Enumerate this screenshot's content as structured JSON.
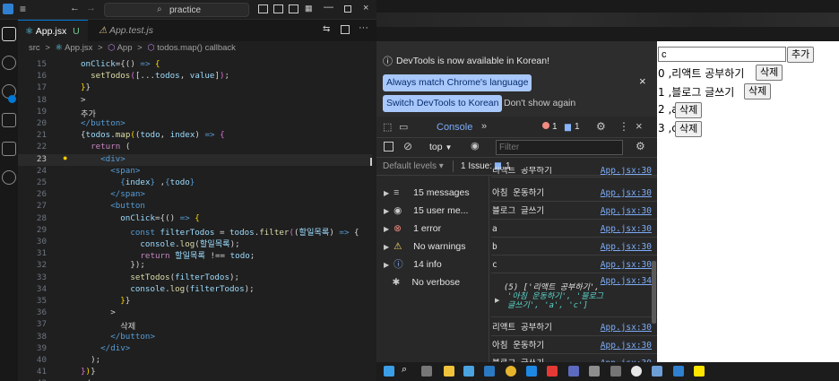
{
  "vscode": {
    "search": "practice",
    "tabs": [
      "App.jsx",
      "U",
      "App.test.js"
    ],
    "breadcrumb": [
      "src",
      ">",
      "App.jsx",
      ">",
      "App",
      ">",
      "todos.map() callback"
    ]
  },
  "code": [
    {
      "n": "15",
      "html": "<span class='v'>onClick</span>={() <span class='tg'>=&gt;</span> <span class='p'>{</span>"
    },
    {
      "n": "16",
      "html": "  <span class='f'>setTodos</span><span class='b'>(</span>[...<span class='v'>todos</span>, <span class='v'>value</span>]<span class='b'>)</span>;"
    },
    {
      "n": "17",
      "html": "<span class='p'>}</span>}"
    },
    {
      "n": "18",
      "html": "&gt;"
    },
    {
      "n": "19",
      "html": "추가"
    },
    {
      "n": "20",
      "html": "<span class='tg'>&lt;/button&gt;</span>"
    },
    {
      "n": "21",
      "html": "{<span class='v'>todos</span>.<span class='f'>map</span><span class='p'>(</span>(<span class='v'>todo</span>, <span class='v'>index</span>) <span class='tg'>=&gt;</span> <span class='b'>{</span>"
    },
    {
      "n": "22",
      "html": "  <span class='k'>return</span> ("
    },
    {
      "n": "23",
      "html": "    <span class='tg'>&lt;div&gt;</span>"
    },
    {
      "n": "24",
      "html": "      <span class='tg'>&lt;span&gt;</span>"
    },
    {
      "n": "25",
      "html": "        <span class='tg'>{</span><span class='v'>index</span><span class='tg'>}</span> ,<span class='tg'>{</span><span class='v'>todo</span><span class='tg'>}</span>"
    },
    {
      "n": "26",
      "html": "      <span class='tg'>&lt;/span&gt;</span>"
    },
    {
      "n": "27",
      "html": "      <span class='tg'>&lt;button</span>"
    },
    {
      "n": "28",
      "html": "        <span class='v'>onClick</span>={() <span class='tg'>=&gt;</span> <span class='p'>{</span>"
    },
    {
      "n": "29",
      "html": "          <span class='tg'>const</span> <span class='v'>filterTodos</span> = <span class='v'>todos</span>.<span class='f'>filter</span><span class='b'>(</span>(<span class='v'>할일목록</span>) <span class='tg'>=&gt;</span> {"
    },
    {
      "n": "30",
      "html": "            <span class='v'>console</span>.<span class='f'>log</span>(<span class='v'>할일목록</span>);"
    },
    {
      "n": "31",
      "html": "            <span class='k'>return</span> <span class='v'>할일목록</span> !== <span class='v'>todo</span>;"
    },
    {
      "n": "32",
      "html": "          });"
    },
    {
      "n": "33",
      "html": "          <span class='f'>setTodos</span>(<span class='v'>filterTodos</span>);"
    },
    {
      "n": "34",
      "html": "          <span class='v'>console</span>.<span class='f'>log</span>(<span class='v'>filterTodos</span>);"
    },
    {
      "n": "35",
      "html": "        <span class='p'>}</span>}"
    },
    {
      "n": "36",
      "html": "      &gt;"
    },
    {
      "n": "37",
      "html": "        삭제"
    },
    {
      "n": "38",
      "html": "      <span class='tg'>&lt;/button&gt;</span>"
    },
    {
      "n": "39",
      "html": "    <span class='tg'>&lt;/div&gt;</span>"
    },
    {
      "n": "40",
      "html": "  );"
    },
    {
      "n": "41",
      "html": "<span class='b'>}</span><span class='p'>)</span>}"
    },
    {
      "n": "42",
      "html": "&lt;/&gt;"
    }
  ],
  "devtools": {
    "banner": "DevTools is now available in Korean!",
    "btn_match": "Always match Chrome's language",
    "btn_switch": "Switch DevTools to Korean",
    "btn_dont": "Don't show again",
    "tab_console": "Console",
    "err_count": "1",
    "msg_count": "1",
    "context": "top",
    "filter_placeholder": "Filter",
    "levels": "Default levels",
    "issues": "1 Issue:",
    "issues_count": "1",
    "sidebar": [
      {
        "label": "15 messages",
        "icon": "≡",
        "color": "#c8c8c8"
      },
      {
        "label": "15 user me...",
        "icon": "◉",
        "color": "#c8c8c8"
      },
      {
        "label": "1 error",
        "icon": "⊗",
        "color": "#f28b82"
      },
      {
        "label": "No warnings",
        "icon": "⚠",
        "color": "#fdd663"
      },
      {
        "label": "14 info",
        "icon": "ⓘ",
        "color": "#8ab4f8"
      },
      {
        "label": "No verbose",
        "icon": "✱",
        "color": "#c8c8c8"
      }
    ],
    "log_top": {
      "msg": "리액트 공부하기",
      "src": "App.jsx:30"
    },
    "logs": [
      {
        "msg": "아침 운동하기",
        "src": "App.jsx:30"
      },
      {
        "msg": "블로그 글쓰기",
        "src": "App.jsx:30"
      },
      {
        "msg": "a",
        "src": "App.jsx:30"
      },
      {
        "msg": "b",
        "src": "App.jsx:30"
      },
      {
        "msg": "c",
        "src": "App.jsx:30"
      }
    ],
    "array_src": "App.jsx:34",
    "array_lines": [
      "(5) ['리액트 공부하기',",
      "'아침 운동하기', '블로그",
      "글쓰기', 'a', 'c']"
    ],
    "logs2": [
      {
        "msg": "리액트 공부하기",
        "src": "App.jsx:30"
      },
      {
        "msg": "아침 운동하기",
        "src": "App.jsx:30"
      },
      {
        "msg": "블로그 글쓰기",
        "src": "App.jsx:30"
      }
    ]
  },
  "page": {
    "input_value": "c",
    "add_label": "추가",
    "delete_label": "삭제",
    "items": [
      "0 ,리액트 공부하기",
      "1 ,블로그 글쓰기",
      "2 ,a",
      "3 ,c"
    ]
  }
}
